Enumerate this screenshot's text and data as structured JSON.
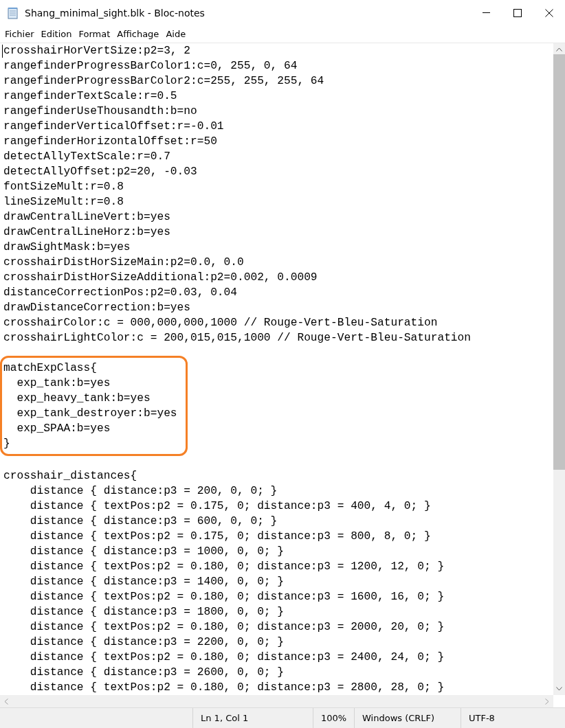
{
  "window": {
    "title": "Shang_minimal_sight.blk - Bloc-notes"
  },
  "menu": [
    "Fichier",
    "Edition",
    "Format",
    "Affichage",
    "Aide"
  ],
  "editor": {
    "blocks": [
      {
        "highlighted": false,
        "lines": [
          "crosshairHorVertSize:p2=3, 2",
          "rangefinderProgressBarColor1:c=0, 255, 0, 64",
          "rangefinderProgressBarColor2:c=255, 255, 255, 64",
          "rangefinderTextScale:r=0.5",
          "rangefinderUseThousandth:b=no",
          "rangefinderVerticalOffset:r=-0.01",
          "rangefinderHorizontalOffset:r=50",
          "detectAllyTextScale:r=0.7",
          "detectAllyOffset:p2=20, -0.03",
          "fontSizeMult:r=0.8",
          "lineSizeMult:r=0.8",
          "drawCentralLineVert:b=yes",
          "drawCentralLineHorz:b=yes",
          "drawSightMask:b=yes",
          "crosshairDistHorSizeMain:p2=0.0, 0.0",
          "crosshairDistHorSizeAdditional:p2=0.002, 0.0009",
          "distanceCorrectionPos:p2=0.03, 0.04",
          "drawDistanceCorrection:b=yes",
          "crosshairColor:c = 000,000,000,1000 // Rouge-Vert-Bleu-Saturation",
          "crosshairLightColor:c = 200,015,015,1000 // Rouge-Vert-Bleu-Saturation"
        ]
      },
      {
        "highlighted": true,
        "lines": [
          "matchExpClass{",
          "  exp_tank:b=yes",
          "  exp_heavy_tank:b=yes",
          "  exp_tank_destroyer:b=yes",
          "  exp_SPAA:b=yes",
          "}"
        ]
      },
      {
        "highlighted": false,
        "lines": [
          "crosshair_distances{",
          "    distance { distance:p3 = 200, 0, 0; }",
          "    distance { textPos:p2 = 0.175, 0; distance:p3 = 400, 4, 0; }",
          "    distance { distance:p3 = 600, 0, 0; }",
          "    distance { textPos:p2 = 0.175, 0; distance:p3 = 800, 8, 0; }",
          "    distance { distance:p3 = 1000, 0, 0; }",
          "    distance { textPos:p2 = 0.180, 0; distance:p3 = 1200, 12, 0; }",
          "    distance { distance:p3 = 1400, 0, 0; }",
          "    distance { textPos:p2 = 0.180, 0; distance:p3 = 1600, 16, 0; }",
          "    distance { distance:p3 = 1800, 0, 0; }",
          "    distance { textPos:p2 = 0.180, 0; distance:p3 = 2000, 20, 0; }",
          "    distance { distance:p3 = 2200, 0, 0; }",
          "    distance { textPos:p2 = 0.180, 0; distance:p3 = 2400, 24, 0; }",
          "    distance { distance:p3 = 2600, 0, 0; }",
          "    distance { textPos:p2 = 0.180, 0; distance:p3 = 2800, 28, 0; }"
        ]
      }
    ]
  },
  "status_bar": [
    "Ln 1, Col 1",
    "100%",
    "Windows (CRLF)",
    "UTF-8"
  ]
}
